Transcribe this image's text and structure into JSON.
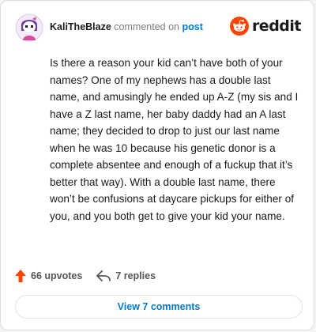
{
  "header": {
    "username": "KaliTheBlaze",
    "action": "commented on",
    "post_link": "post"
  },
  "brand": {
    "name": "reddit",
    "icon": "reddit-logo-icon",
    "color": "#ff4500"
  },
  "comment": {
    "body": "Is there a reason your kid can’t have both of your names? One of my nephews has a double last name, and amusingly he ended up A-Z (my sis and I have a Z last name, her baby daddy had an A last name; they decided to drop to just our last name when he was 10 because his genetic donor is a complete absentee and enough of a fuckup that it’s better that way). With a double last name, there won’t be confusions at daycare pickups for either of you, and you both get to give your kid your name."
  },
  "stats": {
    "upvotes": "66 upvotes",
    "upvote_icon": "upvote-arrow-icon",
    "replies": "7 replies",
    "reply_icon": "reply-icon"
  },
  "view_comments_label": "View 7 comments",
  "colors": {
    "accent": "#0079d3",
    "upvote": "#ff4500",
    "muted": "#7c7c7c"
  }
}
